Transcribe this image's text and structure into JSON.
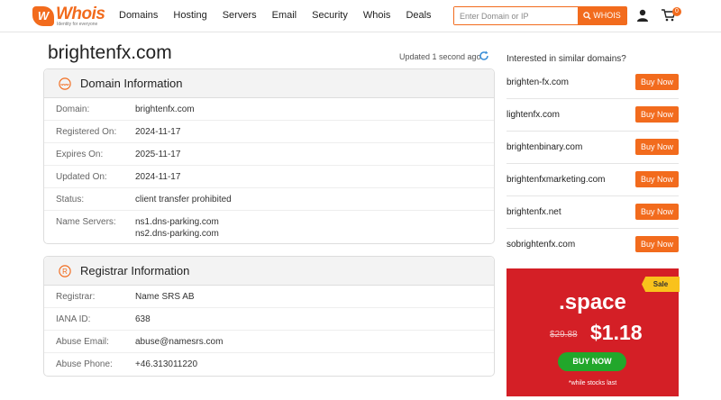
{
  "brand": {
    "logo_mark": "W",
    "name": "Whois",
    "tagline": "Identity for everyone"
  },
  "nav": [
    "Domains",
    "Hosting",
    "Servers",
    "Email",
    "Security",
    "Whois",
    "Deals"
  ],
  "search": {
    "placeholder": "Enter Domain or IP",
    "button_label": "WHOIS"
  },
  "cart": {
    "count": "0"
  },
  "domain": {
    "title": "brightenfx.com",
    "updated": "Updated 1 second ago"
  },
  "domain_info": {
    "heading": "Domain Information",
    "icon": "www-icon",
    "rows": [
      {
        "label": "Domain:",
        "value": "brightenfx.com"
      },
      {
        "label": "Registered On:",
        "value": "2024-11-17"
      },
      {
        "label": "Expires On:",
        "value": "2025-11-17"
      },
      {
        "label": "Updated On:",
        "value": "2024-11-17"
      },
      {
        "label": "Status:",
        "value": "client transfer prohibited"
      },
      {
        "label": "Name Servers:",
        "value": "ns1.dns-parking.com",
        "value2": "ns2.dns-parking.com"
      }
    ]
  },
  "registrar_info": {
    "heading": "Registrar Information",
    "icon": "registered-icon",
    "rows": [
      {
        "label": "Registrar:",
        "value": "Name SRS AB"
      },
      {
        "label": "IANA ID:",
        "value": "638"
      },
      {
        "label": "Abuse Email:",
        "value": "abuse@namesrs.com"
      },
      {
        "label": "Abuse Phone:",
        "value": "+46.313011220"
      }
    ]
  },
  "similar": {
    "title": "Interested in similar domains?",
    "buy_label": "Buy Now",
    "items": [
      "brighten-fx.com",
      "lightenfx.com",
      "brightenbinary.com",
      "brightenfxmarketing.com",
      "brightenfx.net",
      "sobrightenfx.com"
    ]
  },
  "promo": {
    "badge": "Sale",
    "tld": ".space",
    "old_price": "$29.88",
    "new_price": "$1.18",
    "button": "BUY NOW",
    "note": "*while stocks last"
  },
  "colors": {
    "accent": "#f26b1d",
    "promo_bg": "#d41f26",
    "buy_green": "#22a72b",
    "sale_yellow": "#f9c21c"
  }
}
